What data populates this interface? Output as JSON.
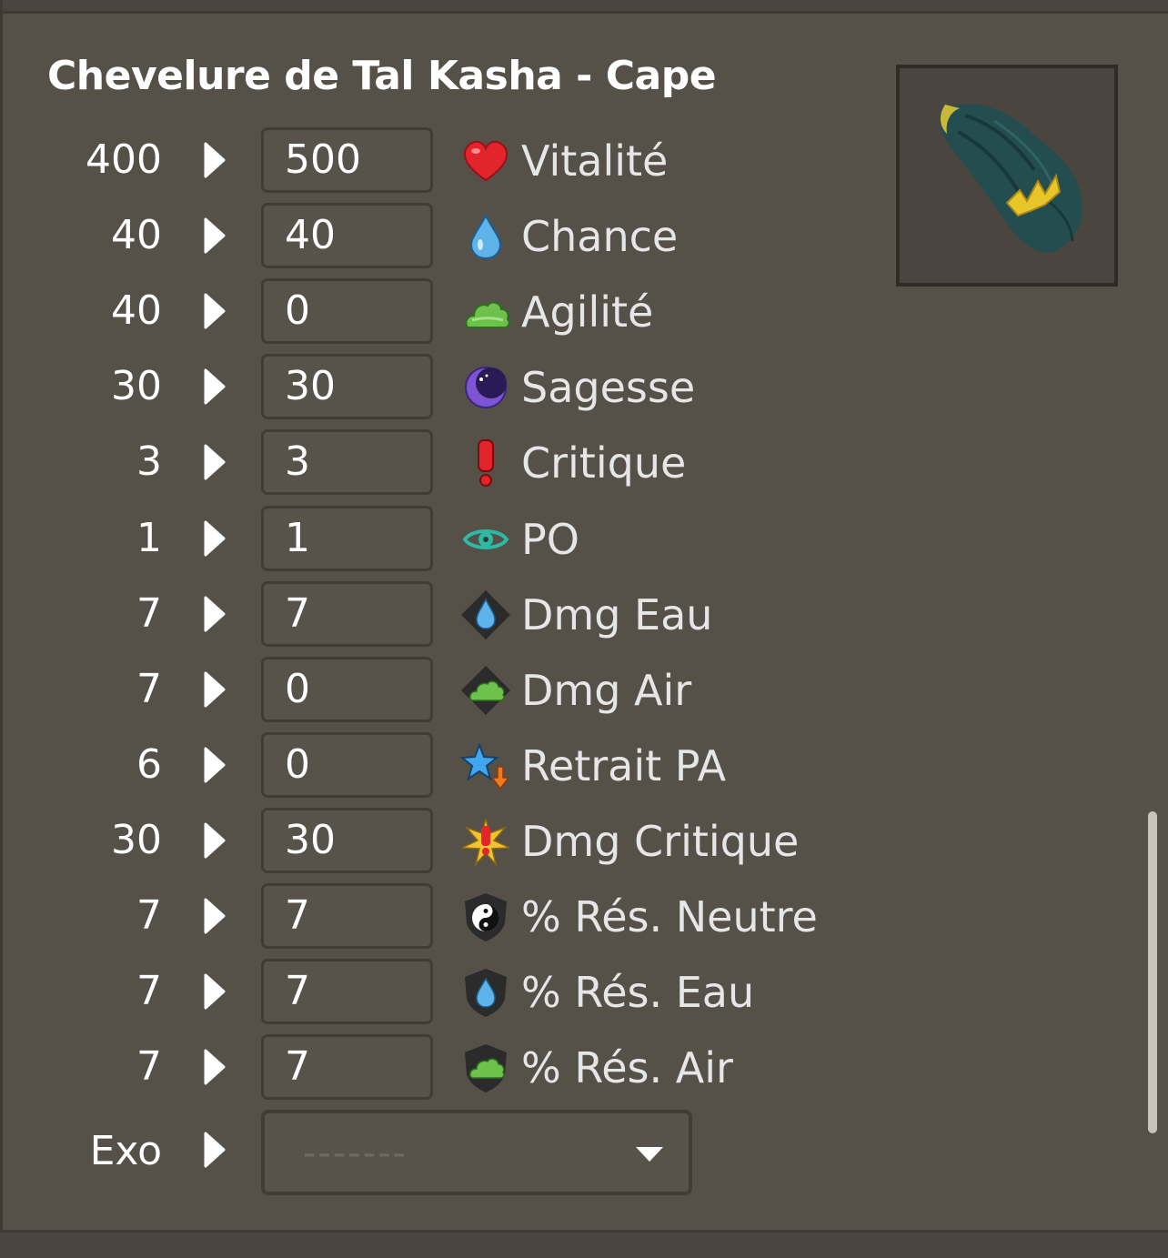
{
  "item": {
    "title": "Chevelure de Tal Kasha - Cape",
    "image_icon": "cape-item-image"
  },
  "stats": [
    {
      "base": "400",
      "value": "500",
      "label": "Vitalité",
      "icon": "heart-icon"
    },
    {
      "base": "40",
      "value": "40",
      "label": "Chance",
      "icon": "water-drop-icon"
    },
    {
      "base": "40",
      "value": "0",
      "label": "Agilité",
      "icon": "air-cloud-icon"
    },
    {
      "base": "30",
      "value": "30",
      "label": "Sagesse",
      "icon": "wisdom-moon-icon"
    },
    {
      "base": "3",
      "value": "3",
      "label": "Critique",
      "icon": "critical-exclamation-icon"
    },
    {
      "base": "1",
      "value": "1",
      "label": "PO",
      "icon": "range-eye-icon"
    },
    {
      "base": "7",
      "value": "7",
      "label": "Dmg Eau",
      "icon": "water-damage-icon"
    },
    {
      "base": "7",
      "value": "0",
      "label": "Dmg Air",
      "icon": "air-damage-icon"
    },
    {
      "base": "6",
      "value": "0",
      "label": "Retrait PA",
      "icon": "ap-reduction-icon"
    },
    {
      "base": "30",
      "value": "30",
      "label": "Dmg Critique",
      "icon": "critical-damage-icon"
    },
    {
      "base": "7",
      "value": "7",
      "label": "% Rés. Neutre",
      "icon": "neutral-resistance-icon"
    },
    {
      "base": "7",
      "value": "7",
      "label": "% Rés. Eau",
      "icon": "water-resistance-icon"
    },
    {
      "base": "7",
      "value": "7",
      "label": "% Rés. Air",
      "icon": "air-resistance-icon"
    }
  ],
  "exo": {
    "label": "Exo",
    "selected": "-------"
  },
  "colors": {
    "background": "#555048",
    "input_border": "#403c36",
    "text": "#ffffff",
    "label": "#e6e6e6"
  }
}
